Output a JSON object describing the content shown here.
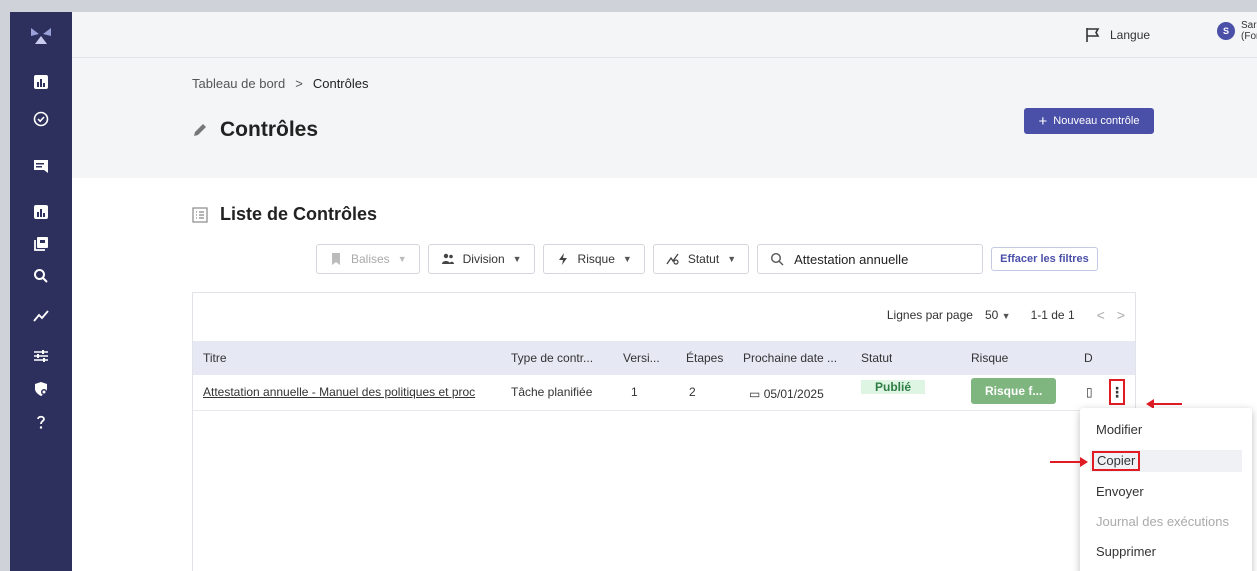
{
  "topbar": {
    "language_label": "Langue",
    "user_initial": "S",
    "user_name_line1": "Sarah",
    "user_name_line2": "(Formation)"
  },
  "breadcrumb": {
    "root": "Tableau de bord",
    "separator": ">",
    "current": "Contrôles"
  },
  "page": {
    "title": "Contrôles",
    "new_button_label": "Nouveau contrôle"
  },
  "list": {
    "title": "Liste de Contrôles",
    "filters": {
      "tags": "Balises",
      "division": "Division",
      "risk": "Risque",
      "status": "Statut",
      "search_value": "Attestation annuelle",
      "clear_label": "Effacer les filtres"
    },
    "pager": {
      "rows_per_page_label": "Lignes par page",
      "rows_per_page_value": "50",
      "range": "1-1 de 1"
    },
    "columns": [
      "Titre",
      "Type de contr...",
      "Versi...",
      "Étapes",
      "Prochaine date ...",
      "Statut",
      "Risque",
      "D"
    ],
    "rows": [
      {
        "title": "Attestation annuelle - Manuel des politiques et proc",
        "type": "Tâche planifiée",
        "version": "1",
        "steps": "2",
        "next_date": "05/01/2025",
        "status": "Publié",
        "risk": "Risque f..."
      }
    ]
  },
  "context_menu": {
    "items": [
      "Modifier",
      "Copier",
      "Envoyer",
      "Journal des exécutions",
      "Supprimer"
    ]
  },
  "colors": {
    "sidebar": "#2d2f5d",
    "accent": "#4a4fa8",
    "annotation": "#e01b24"
  }
}
